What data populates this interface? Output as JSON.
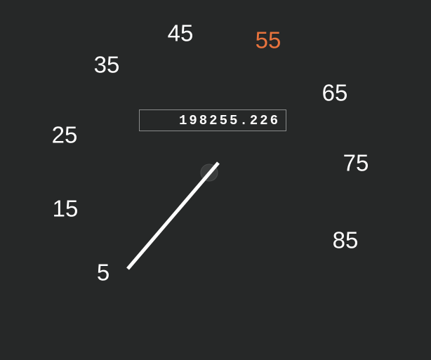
{
  "speedometer": {
    "marks": [
      "5",
      "15",
      "25",
      "35",
      "45",
      "55",
      "65",
      "75",
      "85"
    ],
    "current_mark": "55",
    "highlight_color": "#e8733d",
    "label_color": "#ffffff",
    "needle_color": "#ffffff",
    "background_color": "#262828"
  },
  "odometer": {
    "value": "198255.226"
  }
}
